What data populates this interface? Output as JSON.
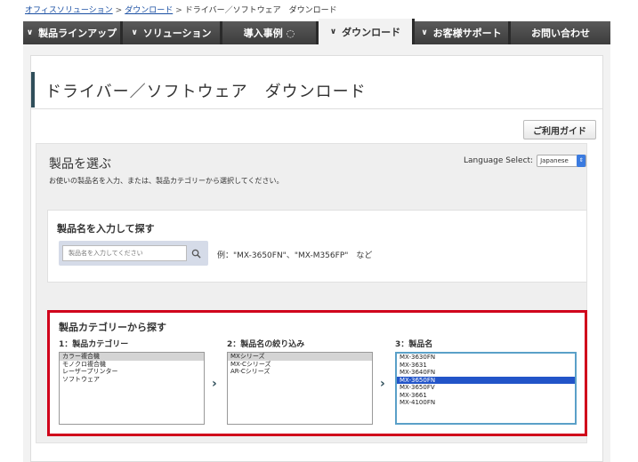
{
  "breadcrumb": {
    "items": [
      "オフィスソリューション",
      "ダウンロード"
    ],
    "current": "ドライバー／ソフトウェア　ダウンロード",
    "separator": ">"
  },
  "nav": {
    "items": [
      {
        "label": "製品ラインアップ",
        "chevron": true
      },
      {
        "label": "ソリューション",
        "chevron": true
      },
      {
        "label": "導入事例 ◌",
        "chevron": false
      },
      {
        "label": "ダウンロード",
        "chevron": true,
        "active": true
      },
      {
        "label": "お客様サポート",
        "chevron": true
      },
      {
        "label": "お問い合わせ",
        "chevron": false
      }
    ]
  },
  "page": {
    "title": "ドライバー／ソフトウェア　ダウンロード",
    "guide_button": "ご利用ガイド"
  },
  "select": {
    "heading": "製品を選ぶ",
    "description": "お使いの製品名を入力、または、製品カテゴリーから選択してください。",
    "language_label": "Language Select:",
    "language_value": "Japanese"
  },
  "name_search": {
    "heading": "製品名を入力して探す",
    "placeholder": "製品名を入力してください",
    "example": "例：\"MX-3650FN\"、\"MX-M356FP\"　など"
  },
  "category": {
    "heading": "製品カテゴリーから探す",
    "col1_label": "1：製品カテゴリー",
    "col2_label": "2：製品名の絞り込み",
    "col3_label": "3：製品名",
    "col1_options": [
      "カラー複合機",
      "モノクロ複合機",
      "レーザープリンター",
      "ソフトウェア"
    ],
    "col2_options": [
      "MXシリーズ",
      "MX-Cシリーズ",
      "AR-Cシリーズ"
    ],
    "col3_options": [
      "MX-3630FN",
      "MX-3631",
      "MX-3640FN",
      "MX-3650FN",
      "MX-3650FV",
      "MX-3661",
      "MX-4100FN"
    ],
    "col1_selected": 0,
    "col2_selected": 0,
    "col3_selected": 3
  },
  "colors": {
    "accent_red": "#d0021b",
    "nav_dark": "#3a3a3a",
    "selected_blue": "#2254c8",
    "title_accent": "#2f4e5a"
  }
}
